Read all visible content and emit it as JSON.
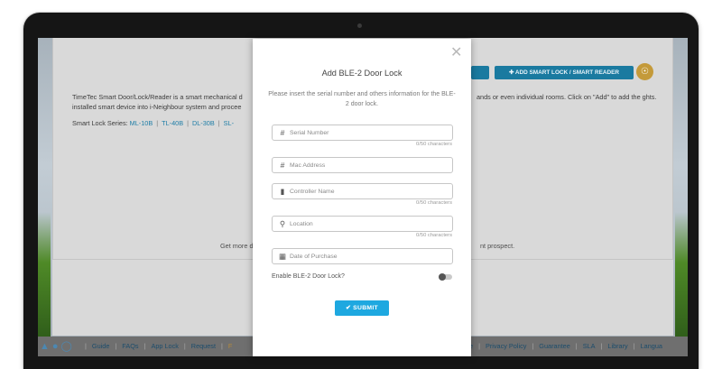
{
  "background_page": {
    "top_buttons": {
      "add_left": "",
      "add_smart_lock": "✚ ADD SMART LOCK / SMART READER"
    },
    "description_left": "TimeTec Smart Door/Lock/Reader is a smart mechanical d installed smart device into i-Neighbour system and procee",
    "description_right": "ands or even individual rooms. Click on \"Add\" to add the ghts.",
    "series_label": "Smart Lock Series:",
    "series": [
      "ML-10B",
      "TL-40B",
      "DL-30B",
      "SL-"
    ],
    "get_more": "Get more detai",
    "prospect": "nt prospect.",
    "footer_left": [
      "Guide",
      "FAQs",
      "App Lock",
      "Request",
      "F"
    ],
    "footer_right": [
      "e",
      "Privacy Policy",
      "Guarantee",
      "SLA",
      "Library",
      "Langua"
    ]
  },
  "modal": {
    "close_icon": "close-icon",
    "title": "Add BLE-2 Door Lock",
    "subtitle": "Please insert the serial number and others information for the BLE-2 door lock.",
    "fields": [
      {
        "icon": "hash-icon",
        "placeholder": "Serial Number",
        "counter": "0/50 characters"
      },
      {
        "icon": "hash-icon",
        "placeholder": "Mac Address",
        "counter": ""
      },
      {
        "icon": "tag-icon",
        "placeholder": "Controller Name",
        "counter": "0/50 characters"
      },
      {
        "icon": "location-pin-icon",
        "placeholder": "Location",
        "counter": "0/50 characters"
      },
      {
        "icon": "calendar-icon",
        "placeholder": "Date of Purchase",
        "counter": ""
      }
    ],
    "toggle_label": "Enable BLE-2 Door Lock?",
    "toggle_on": false,
    "submit_label": "✔ SUBMIT"
  },
  "colors": {
    "accent": "#1ea8e0",
    "dark_blue": "#1a7aa0"
  }
}
